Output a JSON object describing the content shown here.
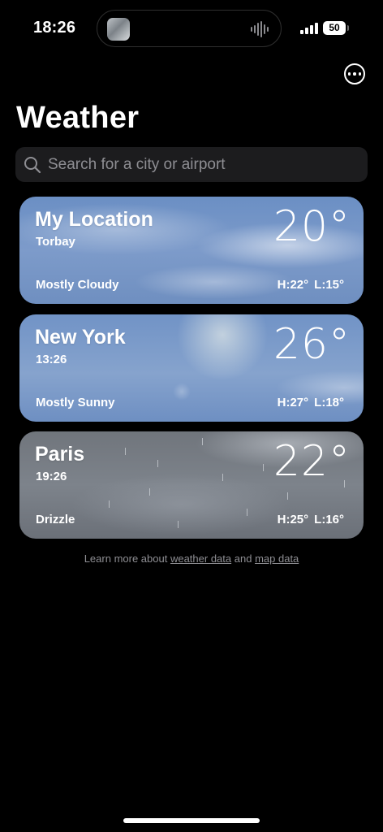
{
  "status_bar": {
    "time": "18:26",
    "battery": "50"
  },
  "header": {
    "title": "Weather",
    "more_icon": "ellipsis-circle-icon"
  },
  "search": {
    "placeholder": "Search for a city or airport",
    "icon": "search-icon"
  },
  "locations": [
    {
      "name": "My Location",
      "subtitle": "Torbay",
      "temperature": "20°",
      "condition": "Mostly Cloudy",
      "high": "H:22°",
      "low": "L:15°"
    },
    {
      "name": "New York",
      "subtitle": "13:26",
      "temperature": "26°",
      "condition": "Mostly Sunny",
      "high": "H:27°",
      "low": "L:18°"
    },
    {
      "name": "Paris",
      "subtitle": "19:26",
      "temperature": "22°",
      "condition": "Drizzle",
      "high": "H:25°",
      "low": "L:16°"
    }
  ],
  "footer": {
    "prefix": "Learn more about",
    "weather_link": "weather data",
    "conjunction": "and",
    "map_link": "map data"
  },
  "colors": {
    "background": "#000000",
    "search_bg": "#1c1c1e",
    "placeholder": "#8e8e93"
  }
}
